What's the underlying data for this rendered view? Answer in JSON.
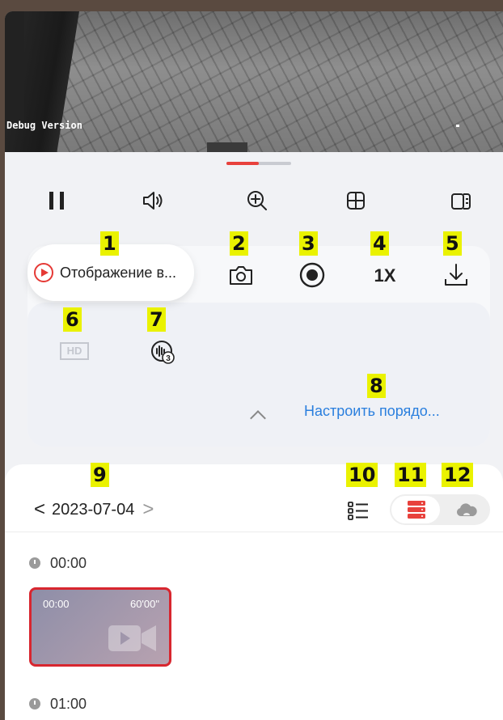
{
  "video": {
    "overlay_text": "Debug Version"
  },
  "playback": {
    "progress": 0.5
  },
  "toolbar": {
    "buttons": [
      "pause",
      "volume",
      "zoom-in",
      "grid",
      "screen-switch"
    ]
  },
  "panel": {
    "pill_label": "Отображение в...",
    "zoom_label": "1X",
    "hd_label": "HD",
    "reorder_label": "Настроить порядо..."
  },
  "badges": [
    "1",
    "2",
    "3",
    "4",
    "5",
    "6",
    "7",
    "8",
    "9",
    "10",
    "11",
    "12"
  ],
  "date_nav": {
    "prev": "<",
    "date": "2023-07-04",
    "next": ">"
  },
  "timeline": [
    {
      "time": "00:00",
      "clip": {
        "start": "00:00",
        "duration": "60'00\""
      }
    },
    {
      "time": "01:00"
    }
  ],
  "colors": {
    "accent": "#e8413c",
    "link": "#2a7fde",
    "badge": "#eaf200"
  }
}
